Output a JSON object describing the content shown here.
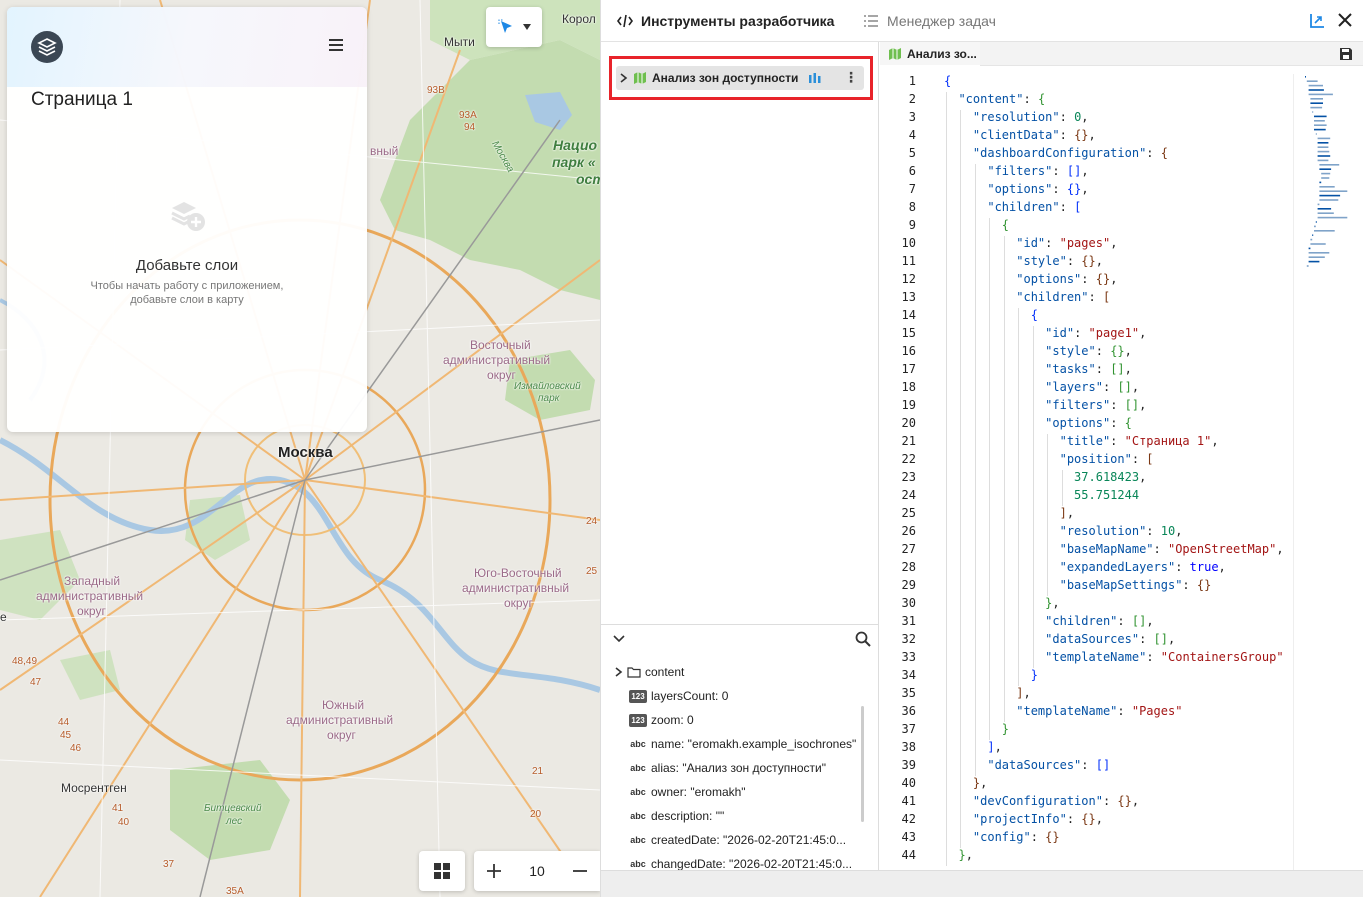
{
  "app": {
    "page_title": "Страница 1",
    "empty_title": "Добавьте слои",
    "empty_subtitle_line1": "Чтобы начать работу с приложением,",
    "empty_subtitle_line2": "добавьте слои в карту"
  },
  "map": {
    "zoom_value": "10",
    "labels": {
      "korol": "Корол",
      "mytishchi": "Мыти",
      "moskva_road": "Москва",
      "nats_park_1": "Нацио",
      "nats_park_2": "парк «",
      "nats_park_3": "ост",
      "vostochny_1": "Восточный",
      "vostochny_2": "административный",
      "vostochny_3": "округ",
      "izmailovsky_1": "Измайловский",
      "izmailovsky_2": "парк",
      "moskva": "Москва",
      "zapadny_1": "Западный",
      "zapadny_2": "административный",
      "zapadny_3": "округ",
      "yugovost_1": "Юго-Восточный",
      "yugovost_2": "административный",
      "yugovost_3": "округ",
      "yuzhny_1": "Южный",
      "yuzhny_2": "административный",
      "yuzhny_3": "округ",
      "mosrentgen": "Мосрентген",
      "bitsevsky_1": "Битцевский",
      "bitsevsky_2": "лес",
      "vyl": "вный",
      "r93b": "93В",
      "r93a": "93А",
      "r94": "94",
      "r4849": "48,49",
      "r47": "47",
      "r44": "44",
      "r45": "45",
      "r46": "46",
      "r41": "41",
      "r40": "40",
      "r37": "37",
      "r35a": "35А",
      "r21": "21",
      "r20": "20",
      "r24": "24",
      "r25": "25",
      "e_letter": "е"
    }
  },
  "devtools": {
    "tab_dev_label": "Инструменты разработчика",
    "tab_tasks_label": "Менеджер задач",
    "tree_item_label": "Анализ зон доступности",
    "editor_tab_label": "Анализ зо...",
    "props": [
      {
        "type": "folder",
        "text": "content"
      },
      {
        "type": "num",
        "badge": "123",
        "text": "layersCount: 0"
      },
      {
        "type": "num",
        "badge": "123",
        "text": "zoom: 0"
      },
      {
        "type": "str",
        "badge": "abc",
        "text": "name: \"eromakh.example_isochrones\""
      },
      {
        "type": "str",
        "badge": "abc",
        "text": "alias: \"Анализ зон доступности\""
      },
      {
        "type": "str",
        "badge": "abc",
        "text": "owner: \"eromakh\""
      },
      {
        "type": "str",
        "badge": "abc",
        "text": "description: \"\""
      },
      {
        "type": "str",
        "badge": "abc",
        "text": "createdDate: \"2026-02-20T21:45:0..."
      },
      {
        "type": "str",
        "badge": "abc",
        "text": "changedDate: \"2026-02-20T21:45:0..."
      }
    ],
    "code_lines": [
      "{",
      "  \"content\": {",
      "    \"resolution\": 0,",
      "    \"clientData\": {},",
      "    \"dashboardConfiguration\": {",
      "      \"filters\": [],",
      "      \"options\": {},",
      "      \"children\": [",
      "        {",
      "          \"id\": \"pages\",",
      "          \"style\": {},",
      "          \"options\": {},",
      "          \"children\": [",
      "            {",
      "              \"id\": \"page1\",",
      "              \"style\": {},",
      "              \"tasks\": [],",
      "              \"layers\": [],",
      "              \"filters\": [],",
      "              \"options\": {",
      "                \"title\": \"Страница 1\",",
      "                \"position\": [",
      "                  37.618423,",
      "                  55.751244",
      "                ],",
      "                \"resolution\": 10,",
      "                \"baseMapName\": \"OpenStreetMap\",",
      "                \"expandedLayers\": true,",
      "                \"baseMapSettings\": {}",
      "              },",
      "              \"children\": [],",
      "              \"dataSources\": [],",
      "              \"templateName\": \"ContainersGroup\"",
      "            }",
      "          ],",
      "          \"templateName\": \"Pages\"",
      "        }",
      "      ],",
      "      \"dataSources\": []",
      "    },",
      "    \"devConfiguration\": {},",
      "    \"projectInfo\": {},",
      "    \"config\": {}",
      "  },"
    ]
  },
  "colors": {
    "accent_red": "#e8232a",
    "key_blue": "#0451a5",
    "string_red": "#a31515",
    "number_green": "#098658"
  }
}
